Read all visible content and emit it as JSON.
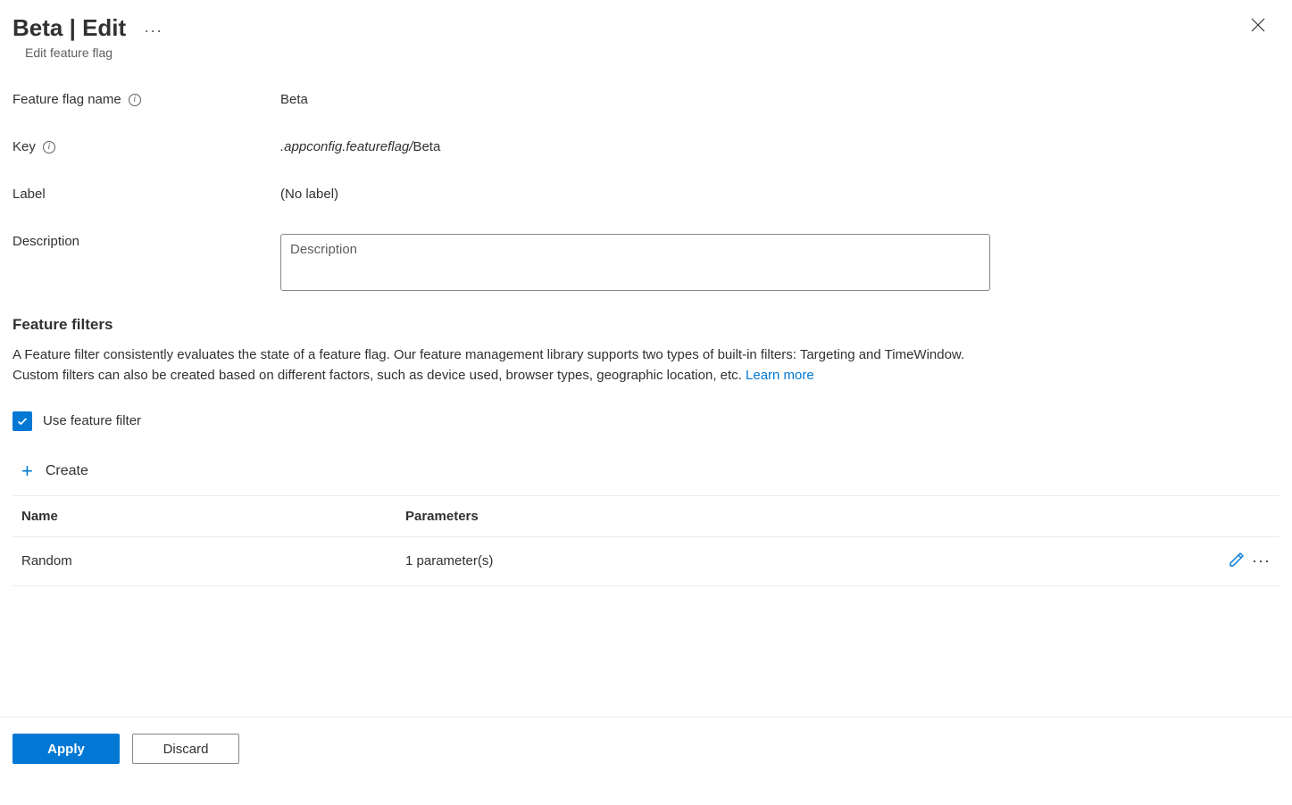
{
  "header": {
    "title": "Beta | Edit",
    "subtitle": "Edit feature flag"
  },
  "form": {
    "name_label": "Feature flag name",
    "name_value": "Beta",
    "key_label": "Key",
    "key_prefix": ".appconfig.featureflag/",
    "key_value": "Beta",
    "label_label": "Label",
    "label_value": "(No label)",
    "description_label": "Description",
    "description_placeholder": "Description",
    "description_value": ""
  },
  "filters": {
    "section_title": "Feature filters",
    "description": "A Feature filter consistently evaluates the state of a feature flag. Our feature management library supports two types of built-in filters: Targeting and TimeWindow. Custom filters can also be created based on different factors, such as device used, browser types, geographic location, etc. ",
    "learn_more": "Learn more",
    "checkbox_label": "Use feature filter",
    "checkbox_checked": true,
    "create_label": "Create",
    "table": {
      "col_name": "Name",
      "col_params": "Parameters",
      "rows": [
        {
          "name": "Random",
          "params": "1 parameter(s)"
        }
      ]
    }
  },
  "footer": {
    "apply": "Apply",
    "discard": "Discard"
  }
}
